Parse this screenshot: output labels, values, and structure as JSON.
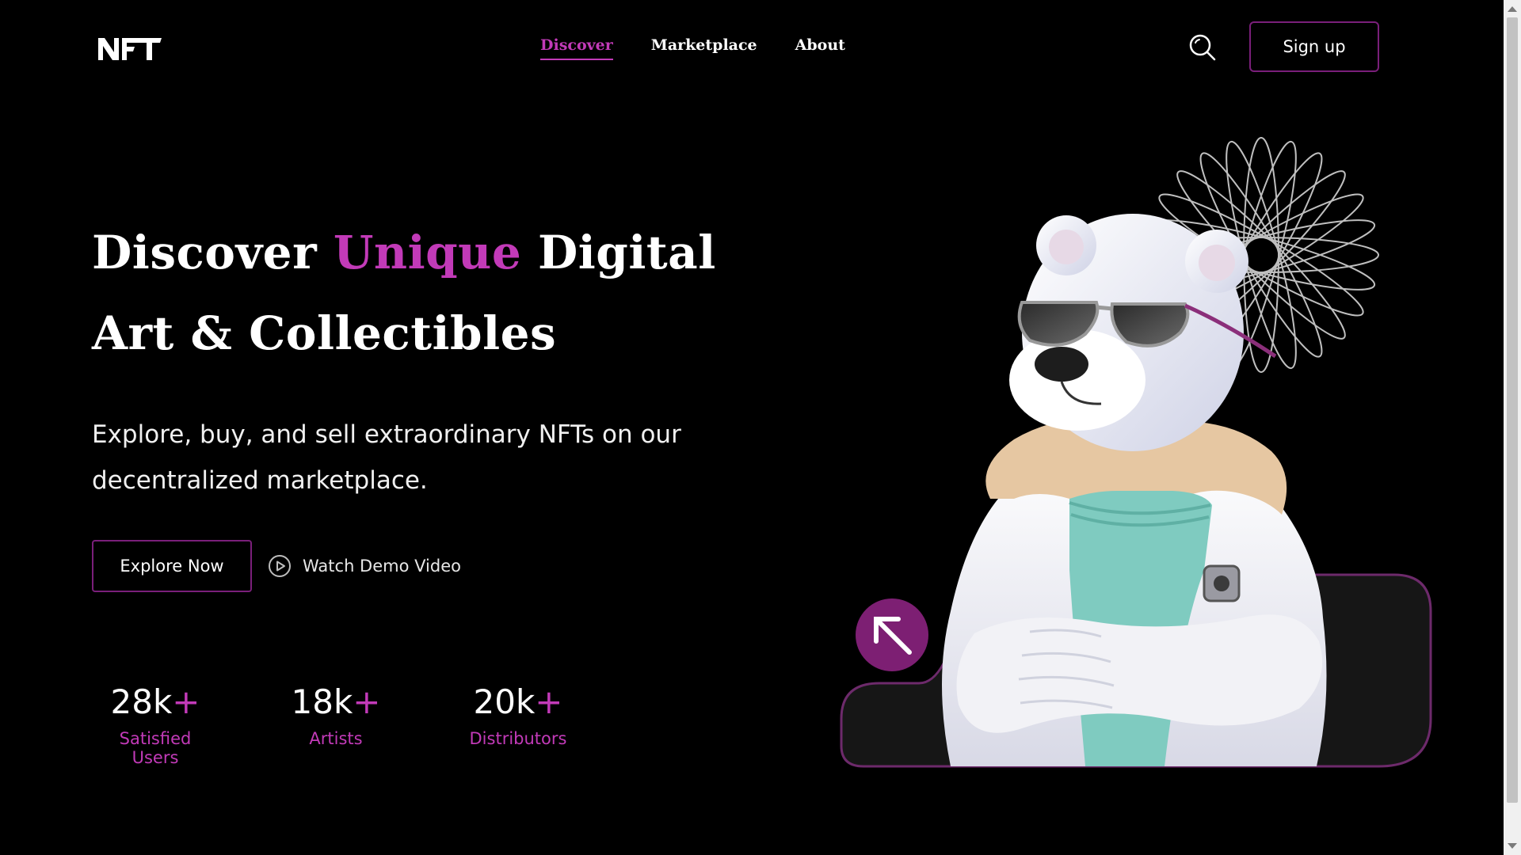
{
  "header": {
    "logo_text": "NFT",
    "nav": [
      {
        "label": "Discover",
        "active": true
      },
      {
        "label": "Marketplace",
        "active": false
      },
      {
        "label": "About",
        "active": false
      }
    ],
    "search_icon": "search-icon",
    "signup_label": "Sign up"
  },
  "hero": {
    "title_part1": "Discover ",
    "title_accent": "Unique",
    "title_part2": " Digital Art & Collectibles",
    "subtitle": "Explore, buy, and sell extraordinary NFTs on our decentralized marketplace.",
    "explore_label": "Explore Now",
    "watch_label": "Watch Demo Video",
    "watch_icon": "play-circle-icon"
  },
  "stats": [
    {
      "value": "28k",
      "suffix": "+",
      "label": "Satisfied Users"
    },
    {
      "value": "18k",
      "suffix": "+",
      "label": "Artists"
    },
    {
      "value": "20k",
      "suffix": "+",
      "label": "Distributors"
    }
  ],
  "art": {
    "illustration": "polar-bear-with-sunglasses",
    "arrow_icon": "arrow-up-left-icon"
  },
  "colors": {
    "background": "#000000",
    "accent": "#c23ab8",
    "border": "#7a1f7a"
  }
}
